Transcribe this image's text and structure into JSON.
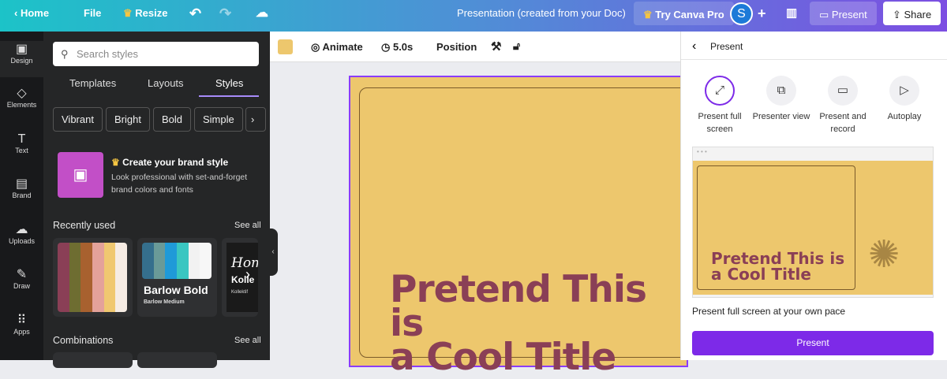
{
  "topbar": {
    "home": "Home",
    "file": "File",
    "resize": "Resize",
    "doc_title": "Presentation (created from your Doc)",
    "try_pro": "Try Canva Pro",
    "avatar": "S",
    "present": "Present",
    "share": "Share"
  },
  "rail": [
    {
      "label": "Design",
      "icon": "▣"
    },
    {
      "label": "Elements",
      "icon": "◇"
    },
    {
      "label": "Text",
      "icon": "T"
    },
    {
      "label": "Brand",
      "icon": "▤"
    },
    {
      "label": "Uploads",
      "icon": "☁"
    },
    {
      "label": "Draw",
      "icon": "✎"
    },
    {
      "label": "Apps",
      "icon": "⠿"
    }
  ],
  "panel": {
    "search_placeholder": "Search styles",
    "tabs": [
      "Templates",
      "Layouts",
      "Styles"
    ],
    "chips": [
      "Vibrant",
      "Bright",
      "Bold",
      "Simple"
    ],
    "brand_title": "Create your brand style",
    "brand_desc": "Look professional with set-and-forget brand colors and fonts",
    "recent": "Recently used",
    "see_all": "See all",
    "combinations": "Combinations",
    "palette1": [
      "#8a3f56",
      "#6e6d31",
      "#a8612f",
      "#e4a29a",
      "#f0c870",
      "#f6ece4"
    ],
    "palette2": [
      "#356f8d",
      "#6a9a98",
      "#1f9ad8",
      "#3ac6c1",
      "#f2f2f2",
      "#f7f7f7"
    ],
    "font_card": {
      "title": "Barlow Bold",
      "sub": "Barlow Medium"
    },
    "font_card2": {
      "script": "Hom",
      "title": "Kolle",
      "sub": "Kollektif"
    }
  },
  "toolbar": {
    "color": "#edc76d",
    "animate": "Animate",
    "duration": "5.0s",
    "position": "Position"
  },
  "slide": {
    "title_line1": "Pretend This is",
    "title_line2": "a Cool Title"
  },
  "present_panel": {
    "header": "Present",
    "options": [
      "Present full screen",
      "Presenter view",
      "Present and record",
      "Autoplay"
    ],
    "desc": "Present full screen at your own pace",
    "button": "Present"
  }
}
